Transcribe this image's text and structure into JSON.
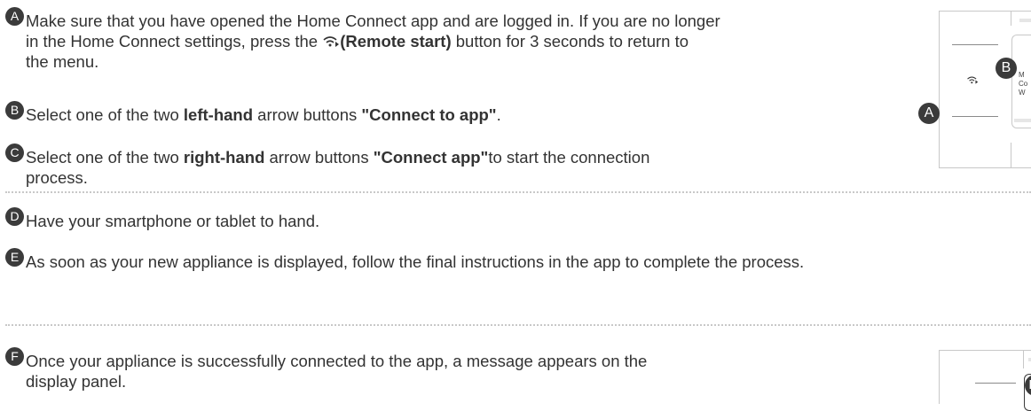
{
  "steps": {
    "a": {
      "badge": "A",
      "line1": "Make sure that you have opened the Home Connect app and are logged in. If you are no longer",
      "line2a": "in the Home Connect settings, press the ",
      "line2b": "(Remote start)",
      "line2c": " button for 3 seconds to return to",
      "line3": "the menu."
    },
    "b": {
      "badge": "B",
      "t1": "Select one of the two ",
      "t2": "left-hand",
      "t3": " arrow buttons ",
      "t4": "\"Connect to app\"",
      "t5": "."
    },
    "c": {
      "badge": "C",
      "t1": "Select one of the two ",
      "t2": "right-hand",
      "t3": " arrow buttons ",
      "t4": "\"Connect app\"",
      "t5": "to start the connection",
      "line2": "process."
    },
    "d": {
      "badge": "D",
      "text": "Have your smartphone or tablet to hand."
    },
    "e": {
      "badge": "E",
      "text": "As soon as your new appliance is displayed, follow the final instructions in the app to complete the process."
    },
    "f": {
      "badge": "F",
      "line1": "Once your appliance is successfully connected to the app, a message appears on the",
      "line2": "display panel."
    }
  },
  "illustration_top": {
    "badge_a": "A",
    "badge_b": "B",
    "cut_text": [
      "M",
      "Co",
      "W"
    ]
  },
  "illustration_bottom": {
    "badge_f": "F"
  },
  "icons": {
    "remote_start": "wifi-remote-icon"
  }
}
